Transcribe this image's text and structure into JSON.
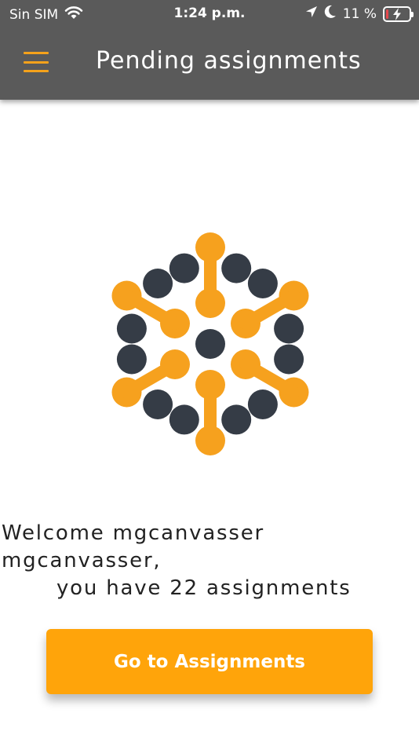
{
  "status_bar": {
    "carrier": "Sin SIM",
    "time": "1:24 p.m.",
    "battery_percent": "11 %",
    "battery_level": 0.11
  },
  "app_bar": {
    "title": "Pending assignments"
  },
  "welcome": {
    "line1": "Welcome mgcanvasser",
    "line2": "mgcanvasser,",
    "line3": "you have 22 assignments"
  },
  "actions": {
    "go_label": "Go to Assignments"
  },
  "colors": {
    "accent": "#ffa40a",
    "logo_orange": "#f6a11e",
    "logo_dark": "#353c46",
    "header_bg": "#5a5a5a"
  },
  "icons": {
    "menu": "hamburger-menu-icon",
    "wifi": "wifi-icon",
    "location": "location-arrow-icon",
    "moon": "moon-icon",
    "battery": "battery-charging-icon"
  }
}
